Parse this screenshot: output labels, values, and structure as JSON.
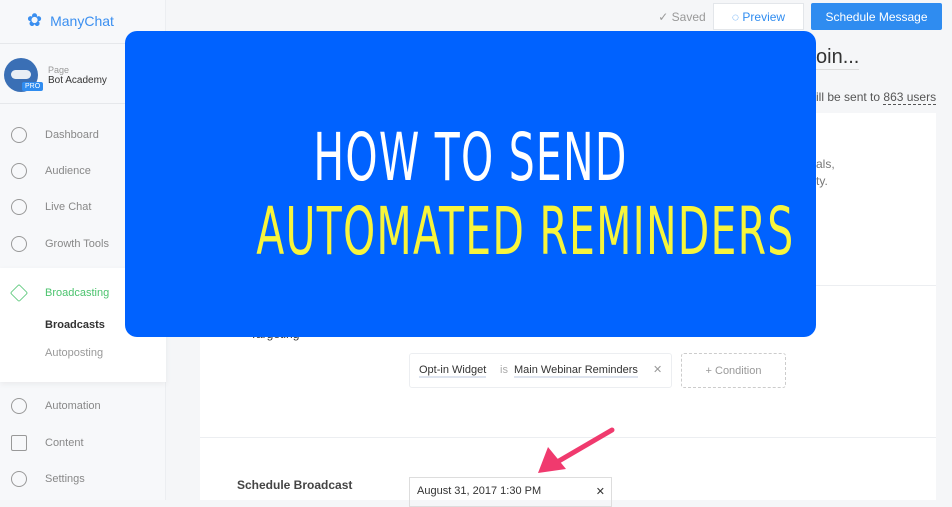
{
  "sidebar": {
    "brand": "ManyChat",
    "page_label": "Page",
    "page_name": "Bot Academy",
    "badge": "PRO",
    "items": [
      {
        "label": "Dashboard",
        "icon": "dashboard-icon"
      },
      {
        "label": "Audience",
        "icon": "user-icon"
      },
      {
        "label": "Live Chat",
        "icon": "chat-icon"
      },
      {
        "label": "Growth Tools",
        "icon": "magnet-icon"
      },
      {
        "label": "Broadcasting",
        "icon": "send-icon"
      },
      {
        "label": "Automation",
        "icon": "atom-icon"
      },
      {
        "label": "Content",
        "icon": "folder-icon"
      },
      {
        "label": "Settings",
        "icon": "gear-icon"
      }
    ],
    "sub_items": [
      {
        "label": "Broadcasts"
      },
      {
        "label": "Autoposting"
      }
    ]
  },
  "topbar": {
    "saved": "Saved",
    "preview": "Preview",
    "schedule": "Schedule Message"
  },
  "main": {
    "title_fragment": "oin...",
    "sent_fragment": "ill be sent to",
    "users": "863 users",
    "desc1": "als,",
    "desc2": "ty.",
    "targeting_label": "Targeting",
    "condition_field": "Opt-in Widget",
    "condition_op": "is",
    "condition_value": "Main Webinar Reminders",
    "add_condition": "+ Condition",
    "schedule_label": "Schedule Broadcast",
    "schedule_value": "August 31, 2017 1:30 PM"
  },
  "overlay": {
    "line1": "HOW TO SEND",
    "line2": "AUTOMATED REMINDERS"
  },
  "colors": {
    "accent": "#2f8cf0",
    "active": "#4cc36e",
    "overlay": "#0062ff",
    "headline_yellow": "#f7f53c",
    "arrow": "#f03a6e"
  }
}
